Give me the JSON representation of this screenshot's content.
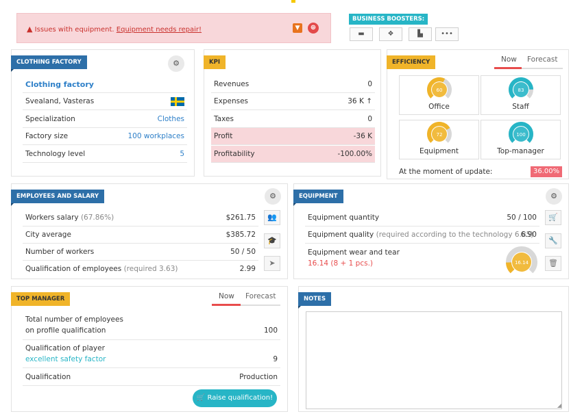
{
  "alert": {
    "message": "Issues with equipment.",
    "link": "Equipment needs repair!",
    "icons": [
      "warning-triangle-icon",
      "box-icon",
      "lifebuoy-icon"
    ]
  },
  "boosters": {
    "title": "BUSINESS BOOSTERS:",
    "buttons": [
      "briefcase-icon",
      "dropbox-icon",
      "factory-icon",
      "more-icon"
    ]
  },
  "clothing_factory": {
    "title": "CLOTHING FACTORY",
    "name": "Clothing factory",
    "location": "Svealand, Vasteras",
    "flag": "sweden-flag-icon",
    "specialization_label": "Specialization",
    "specialization_value": "Clothes",
    "size_label": "Factory size",
    "size_value": "100 workplaces",
    "tech_label": "Technology level",
    "tech_value": "5"
  },
  "kpi": {
    "title": "KPI",
    "rows": [
      {
        "label": "Revenues",
        "value": "0"
      },
      {
        "label": "Expenses",
        "value": "36 K"
      },
      {
        "label": "Taxes",
        "value": "0"
      },
      {
        "label": "Profit",
        "value": "-36 K"
      },
      {
        "label": "Profitability",
        "value": "-100.00%"
      }
    ]
  },
  "efficiency": {
    "title": "EFFICIENCY",
    "tab_now": "Now",
    "tab_forecast": "Forecast",
    "boxes": [
      {
        "label": "Office",
        "value": "60",
        "fraction": 0.6,
        "color": "#f0b429"
      },
      {
        "label": "Staff",
        "value": "83",
        "fraction": 0.83,
        "color": "#27b5c6"
      },
      {
        "label": "Equipment",
        "value": "72",
        "fraction": 0.72,
        "color": "#f0b429"
      },
      {
        "label": "Top-manager",
        "value": "100",
        "fraction": 1.0,
        "color": "#27b5c6"
      }
    ],
    "moment_label": "At the moment of update:",
    "moment_value": "36.00%"
  },
  "employees": {
    "title": "EMPLOYEES AND SALARY",
    "salary_label": "Workers salary",
    "salary_pct": "(67.86%)",
    "salary_value": "$261.75",
    "city_label": "City average",
    "city_value": "$385.72",
    "workers_label": "Number of workers",
    "workers_value": "50 / 50",
    "qual_label": "Qualification of employees",
    "qual_req": "(required 3.63)",
    "qual_value": "2.99"
  },
  "equipment": {
    "title": "EQUIPMENT",
    "qty_label": "Equipment quantity",
    "qty_value": "50 / 100",
    "quality_label": "Equipment quality",
    "quality_req": "(required according to the technology 6.85)",
    "quality_value": "6.90",
    "wear_label": "Equipment wear and tear",
    "wear_detail": "16.14 (8 + 1 pcs.)",
    "wear_gauge": "16.14",
    "wear_fraction": 0.1614
  },
  "top_manager": {
    "title": "TOP MANAGER",
    "tab_now": "Now",
    "tab_forecast": "Forecast",
    "row1_label_a": "Total number of employees",
    "row1_label_b": "on profile qualification",
    "row1_value": "100",
    "row2_label": "Qualification of player",
    "row2_sub": "excellent safety factor",
    "row2_value": "9",
    "row3_label": "Qualification",
    "row3_value": "Production",
    "raise_button": "Raise qualification!"
  },
  "notes": {
    "title": "NOTES",
    "value": ""
  }
}
